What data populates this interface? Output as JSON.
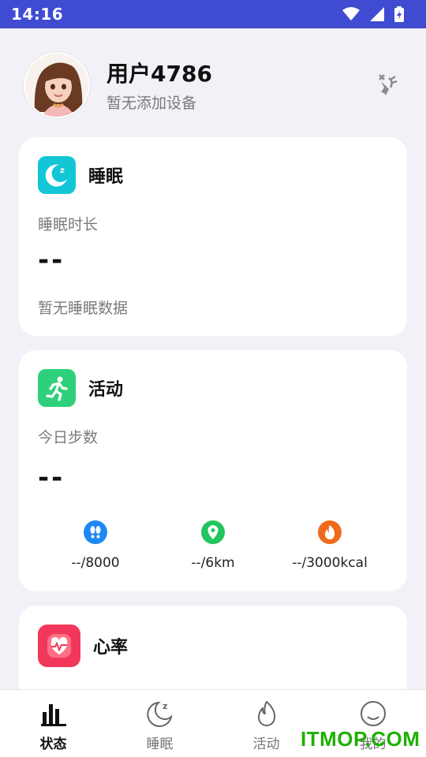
{
  "status_bar": {
    "time": "14:16"
  },
  "profile": {
    "name": "用户4786",
    "subtitle": "暂无添加设备"
  },
  "sleep_card": {
    "title": "睡眠",
    "label": "睡眠时长",
    "value": "--",
    "note": "暂无睡眠数据",
    "icon": "moon-icon",
    "color": "#12c6d6"
  },
  "activity_card": {
    "title": "活动",
    "label": "今日步数",
    "value": "--",
    "icon": "running-icon",
    "color": "#2fd07b",
    "stats": [
      {
        "icon": "footprints-icon",
        "text": "--/8000",
        "color": "#1e88f2"
      },
      {
        "icon": "location-icon",
        "text": "--/6km",
        "color": "#22c55e"
      },
      {
        "icon": "fire-icon",
        "text": "--/3000kcal",
        "color": "#f06a1d"
      }
    ]
  },
  "heart_card": {
    "title": "心率",
    "icon": "heart-icon",
    "color": "#f2385a"
  },
  "tabs": [
    {
      "label": "状态",
      "icon": "bar-chart-icon",
      "active": true
    },
    {
      "label": "睡眠",
      "icon": "moon-icon",
      "active": false
    },
    {
      "label": "活动",
      "icon": "flame-icon",
      "active": false
    },
    {
      "label": "我的",
      "icon": "smile-icon",
      "active": false
    }
  ],
  "watermark": "ITMOP.COM"
}
